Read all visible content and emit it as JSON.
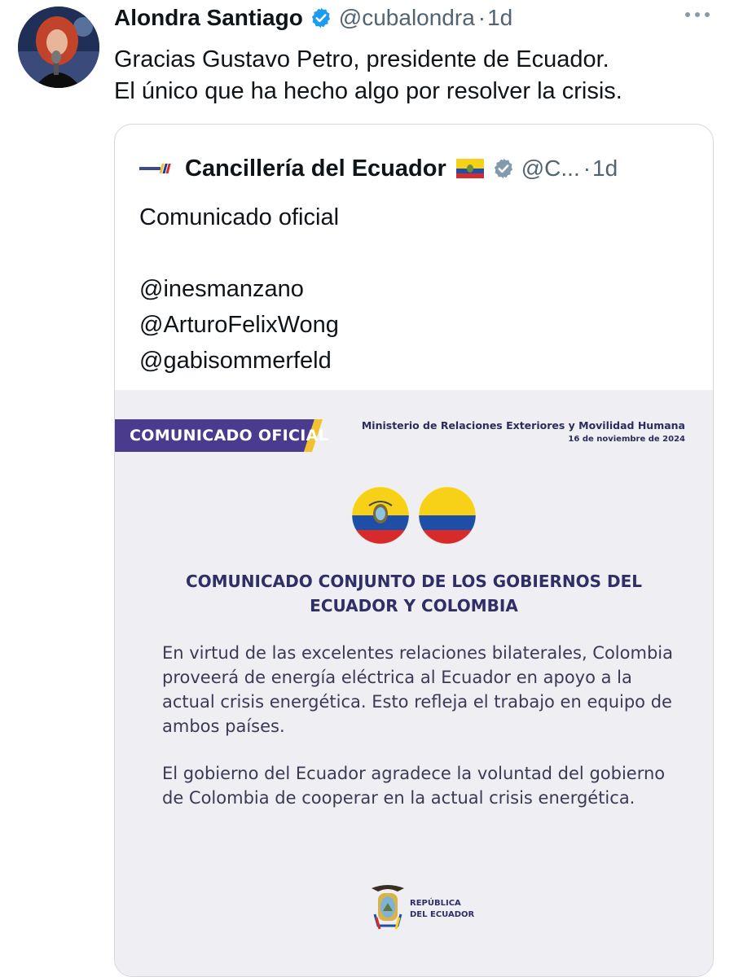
{
  "tweet": {
    "author_name": "Alondra Santiago",
    "handle": "@cubalondra",
    "separator": "·",
    "time": "1d",
    "text_lines": [
      "Gracias Gustavo Petro, presidente de Ecuador.",
      "El único que ha hecho algo por resolver la crisis."
    ],
    "icons": {
      "verified": "verified-badge-icon",
      "more": "more-options-icon"
    },
    "accent_color": "#1d9bf0"
  },
  "quote": {
    "author_name": "Cancillería del Ecuador",
    "handle": "@C...",
    "separator": "·",
    "time": "1d",
    "text_lines": [
      "Comunicado oficial",
      "",
      "@inesmanzano",
      "@ArturoFelixWong",
      "@gabisommerfeld"
    ],
    "icons": {
      "verified": "verified-gray-badge-icon",
      "flag": "ecuador-flag-emoji-icon"
    }
  },
  "communique": {
    "banner": "COMUNICADO OFICIAL",
    "ministry": "Ministerio de Relaciones Exteriores y Movilidad Humana",
    "date": "16 de noviembre de 2024",
    "title_lines": [
      "COMUNICADO CONJUNTO DE LOS GOBIERNOS DEL",
      "ECUADOR Y COLOMBIA"
    ],
    "paragraph1_lines": [
      "En virtud de las excelentes relaciones bilaterales, Colombia",
      "proveerá de energía eléctrica al Ecuador en apoyo a la",
      "actual crisis energética. Esto refleja el trabajo en equipo de",
      "ambos países."
    ],
    "paragraph2_lines": [
      "El gobierno del Ecuador agradece la voluntad del gobierno",
      "de Colombia de cooperar en la actual crisis energética."
    ],
    "footer_lines": [
      "REPÚBLICA",
      "DEL ECUADOR"
    ],
    "colors": {
      "banner": "#4a3b8f",
      "accent": "#f2c12e",
      "title": "#2e2f66"
    }
  }
}
